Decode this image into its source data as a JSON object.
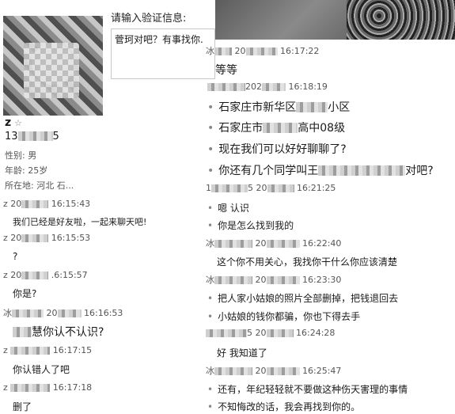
{
  "profile": {
    "name": "z",
    "star": "☆",
    "phone_prefix": "13",
    "phone_suffix": "5",
    "gender": "性别: 男",
    "age": "年龄: 25岁",
    "location": "所在地: 河北  石..."
  },
  "verify": {
    "label": "请输入验证信息:",
    "value": "菅珂对吧？有事找你."
  },
  "left_chat": [
    {
      "sender": "z 20",
      "time": "16:15:43",
      "text": "我们已经是好友啦，一起来聊天吧!"
    },
    {
      "sender": "z 20",
      "time": "16:15:53",
      "text": "?"
    },
    {
      "sender": "z 20",
      "time": ".6:15:57",
      "text": "你是?"
    },
    {
      "sender": "冰",
      "mid": "20",
      "time": "16:16:53",
      "text": "慧你认不认识?"
    },
    {
      "sender": "z",
      "time": "16:17:15",
      "text": "你认错人了吧"
    },
    {
      "sender": "z",
      "time": "16:17:18",
      "text": "删了"
    }
  ],
  "right_chat": [
    {
      "sender": "冰",
      "mid": "20",
      "time": "16:17:22"
    },
    {
      "text": "等等"
    },
    {
      "mid": "202",
      "time": "16:18:19"
    },
    {
      "text_a": "石家庄市新华区",
      "text_b": "小区"
    },
    {
      "text_a": "石家庄市",
      "text_b": "高中08级"
    },
    {
      "text": "现在我们可以好好聊聊了?"
    },
    {
      "text_a": "你还有几个同学叫王",
      "text_b": "对吧?"
    },
    {
      "sender": "1",
      "mid": "5 20",
      "time": "16:21:25"
    },
    {
      "text": "嗯 认识"
    },
    {
      "text": "你是怎么找到我的"
    },
    {
      "sender": "冰",
      "mid": "20",
      "time": "16:22:40"
    },
    {
      "text": "这个你不用关心，我找你干什么你应该清楚"
    },
    {
      "sender": "冰",
      "mid": "20",
      "time": "16:23:30"
    },
    {
      "text": "把人家小姑娘的照片全部删掉，把钱退回去"
    },
    {
      "text": "小姑娘的钱你都骗，你也下得去手"
    },
    {
      "mid": "5 20",
      "time": "16:24:28"
    },
    {
      "text": "好 我知道了"
    },
    {
      "sender": "冰",
      "mid": "20",
      "time": "16:25:47"
    },
    {
      "text": "还有，年纪轻轻就不要做这种伤天害理的事情"
    },
    {
      "text": "不知悔改的话，我会再找到你的。"
    }
  ]
}
